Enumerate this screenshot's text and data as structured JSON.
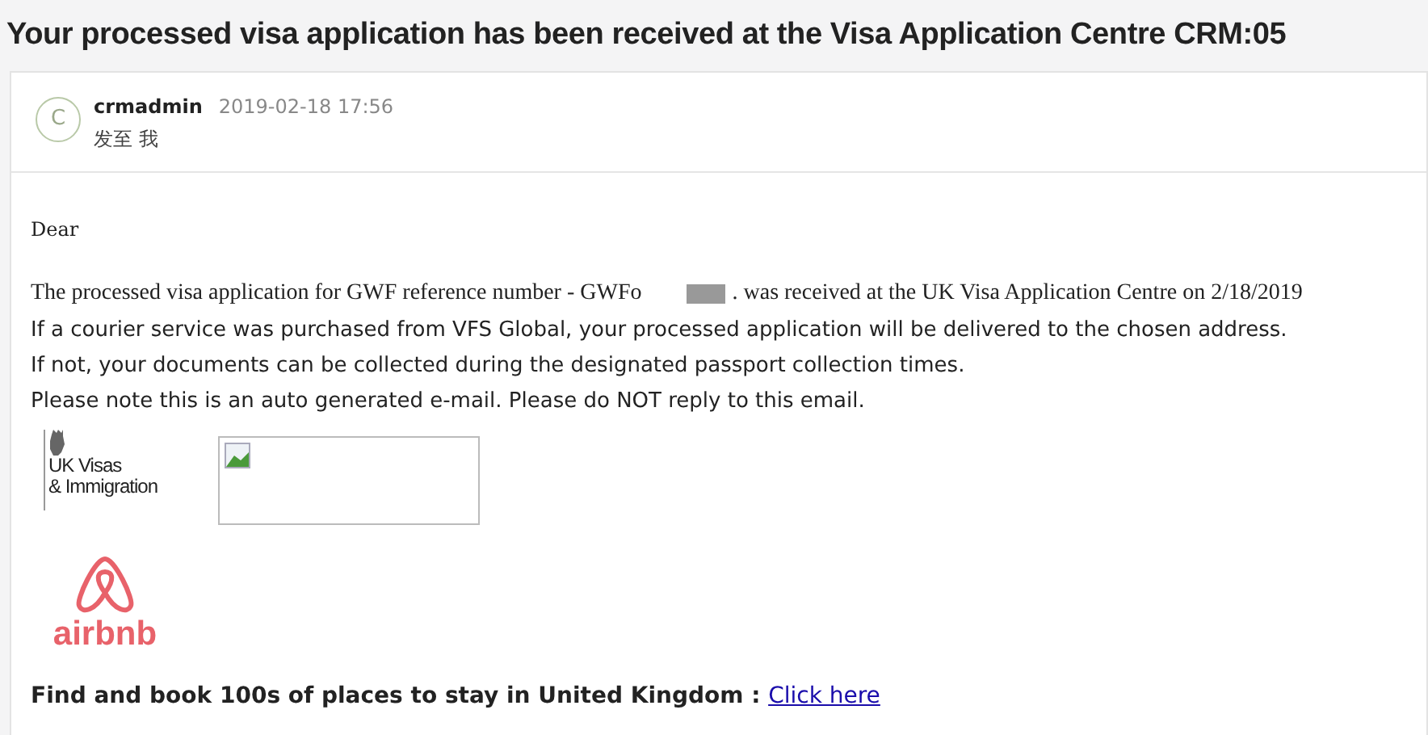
{
  "subject": "Your processed visa application has been received at the Visa Application Centre CRM:05",
  "sender": {
    "avatar": "C",
    "name": "crmadmin",
    "date": "2019-02-18 17:56",
    "recipients": "发至 我"
  },
  "body": {
    "greeting": "Dear",
    "reference_line": {
      "before": "The processed visa application for GWF reference number -  GWFo",
      "after": ". was received at the UK Visa Application Centre on  2/18/2019"
    },
    "lines": [
      "If a courier service was purchased from VFS Global, your processed application will be delivered to the chosen address.",
      "If not, your documents can be collected during the designated passport collection times.",
      "Please note this is an auto generated e-mail. Please do NOT reply to this email."
    ],
    "ukvi_logo": [
      "UK Visas",
      "& Immigration"
    ],
    "brand_logo": "airbnb",
    "footer": {
      "text": "Find and book 100s of places to stay in United Kingdom :",
      "link": "Click here"
    }
  }
}
